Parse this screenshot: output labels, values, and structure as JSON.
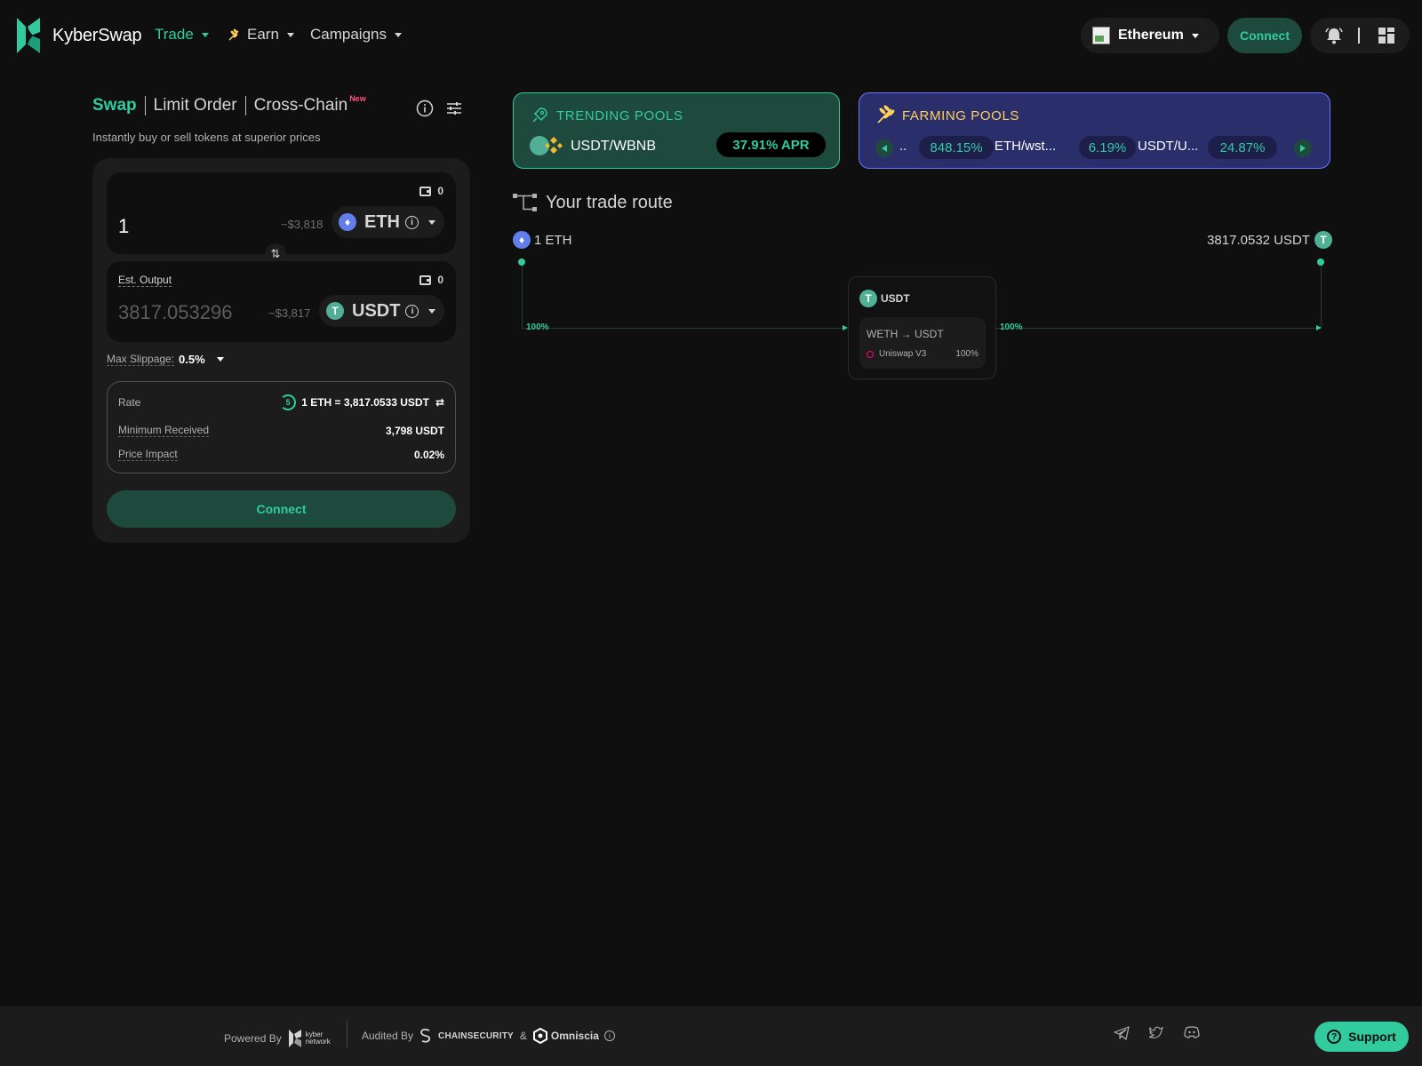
{
  "header": {
    "brand": "KyberSwap",
    "nav": [
      {
        "label": "Trade",
        "icon": "chevron-down-icon"
      },
      {
        "label": "Earn",
        "icon": "chevron-down-icon"
      },
      {
        "label": "Campaigns",
        "icon": "chevron-down-icon"
      }
    ],
    "network": "Ethereum",
    "connect_label": "Connect"
  },
  "swap": {
    "tabs": [
      "Swap",
      "Limit Order",
      "Cross-Chain"
    ],
    "new_badge": "New",
    "subtitle": "Instantly buy or sell tokens at superior prices",
    "from": {
      "balance": "0",
      "amount": "1",
      "usd": "~$3,818",
      "token": "ETH"
    },
    "to": {
      "label": "Est. Output",
      "balance": "0",
      "amount": "3817.053296",
      "usd": "~$3,817",
      "token": "USDT"
    },
    "slippage_label": "Max Slippage:",
    "slippage_value": "0.5%",
    "rate_label": "Rate",
    "rate_countdown": "5",
    "rate_value": "1 ETH = 3,817.0533 USDT",
    "min_received_label": "Minimum Received",
    "min_received_value": "3,798 USDT",
    "price_impact_label": "Price Impact",
    "price_impact_value": "0.02%",
    "connect_label": "Connect"
  },
  "trending": {
    "title": "TRENDING POOLS",
    "pair": "USDT/WBNB",
    "apr": "37.91% APR"
  },
  "farming": {
    "title": "FARMING POOLS",
    "items": [
      {
        "name": "..",
        "apr": "848.15%"
      },
      {
        "name": "ETH/wst...",
        "apr": "6.19%"
      },
      {
        "name": "USDT/U...",
        "apr": "24.87%"
      }
    ]
  },
  "route": {
    "title": "Your trade route",
    "from": "1 ETH",
    "to": "3817.0532 USDT",
    "left_pct": "100%",
    "right_pct": "100%",
    "hop_token": "USDT",
    "hop_pair": "WETH → USDT",
    "hop_dex": "Uniswap V3",
    "hop_pct": "100%"
  },
  "footer": {
    "powered_by": "Powered By",
    "kyber_line1": "kyber",
    "kyber_line2": "network",
    "audited_by": "Audited By",
    "chainsecurity": "CHAINSECURITY",
    "amp": "&",
    "omniscia": "Omniscia",
    "support": "Support"
  },
  "colors": {
    "accent": "#31cb9e",
    "background": "#0f0f0f",
    "card": "#1c1c1c",
    "farming_bg": "#2a2e6b",
    "farming_title": "#ffd15c"
  }
}
